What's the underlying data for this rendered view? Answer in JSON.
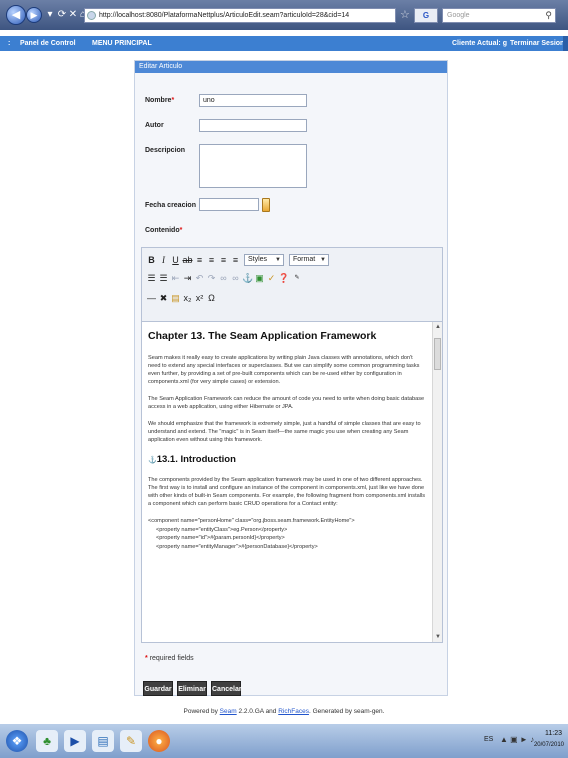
{
  "browser": {
    "url": "http://localhost:8080/PlataformaNettplus/ArticuloEdit.seam?articuloId=28&cid=14",
    "search_placeholder": "Google",
    "search_engine_mark": "G"
  },
  "appbar": {
    "panel_control": "Panel de Control",
    "menu_principal": "MENU PRINCIPAL",
    "cliente_actual": "Cliente Actual: g",
    "terminar_sesion": "Terminar Sesion"
  },
  "form": {
    "header": "Editar Articulo",
    "nombre_label": "Nombre",
    "nombre_value": "uno",
    "autor_label": "Autor",
    "autor_value": "",
    "descripcion_label": "Descripcion",
    "descripcion_value": "",
    "fecha_label": "Fecha creacion",
    "fecha_value": "",
    "contenido_label": "Contenido",
    "required_mark": "*"
  },
  "editor": {
    "styles_select": "Styles",
    "format_select": "Format",
    "heading1": "Chapter 13. The Seam Application Framework",
    "p1": "Seam makes it really easy to create applications by writing plain Java classes with annotations, which don't need to extend any special interfaces or superclasses. But we can simplify some common programming tasks even further, by providing a set of pre-built components which can be re-used either by configuration in components.xml (for very simple cases) or extension.",
    "p2": "The Seam Application Framework can reduce the amount of code you need to write when doing basic database access in a web application, using either Hibernate or JPA.",
    "p3": "We should emphasize that the framework is extremely simple, just a handful of simple classes that are easy to understand and extend. The \"magic\" is in Seam itself—the same magic you use when creating any Seam application even without using this framework.",
    "heading2": "13.1. Introduction",
    "p4": "The components provided by the Seam application framework may be used in one of two different approaches. The first way is to install and configure an instance of the component in components.xml, just like we have done with other kinds of built-in Seam components. For example, the following fragment from components.xml installs a component which can perform basic CRUD operations for a Contact entity:",
    "xml": [
      "<component name=\"personHome\" class=\"org.jboss.seam.framework.EntityHome\">",
      "<property name=\"entityClass\">eg.Person</property>",
      "<property name=\"id\">#{param.personId}</property>",
      "<property name=\"entityManager\">#{personDatabase}</property>"
    ]
  },
  "required_note": "required fields",
  "buttons": {
    "guardar": "Guardar",
    "eliminar": "Eliminar",
    "cancelar": "Cancelar"
  },
  "footer": {
    "powered_by": "Powered by",
    "seam_link": "Seam",
    "version": "2.2.0.GA and",
    "richfaces_link": "RichFaces",
    "generated": ". Generated by seam-gen."
  },
  "taskbar": {
    "language": "ES",
    "time": "11:23",
    "date": "20/07/2010"
  }
}
